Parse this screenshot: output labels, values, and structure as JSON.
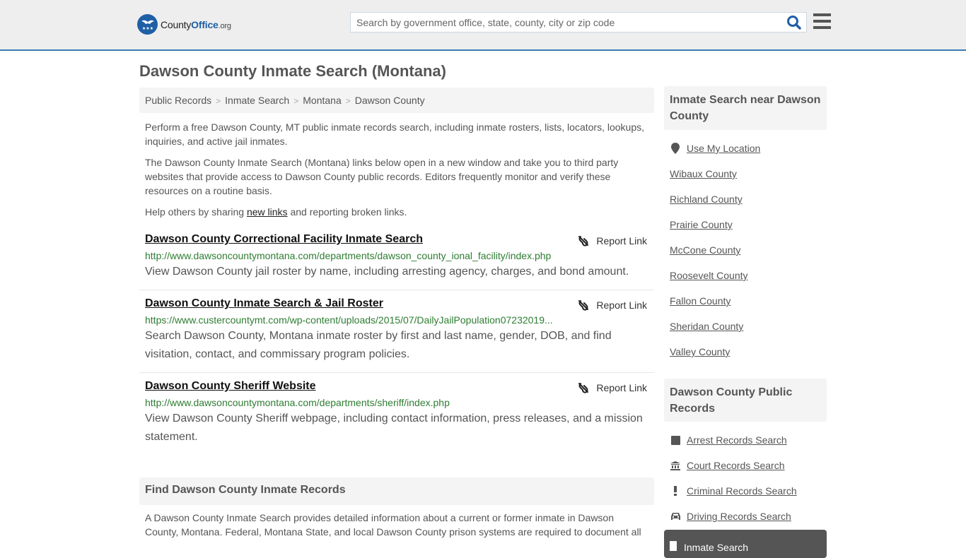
{
  "header": {
    "logo": {
      "name_part1": "County",
      "name_part2": "Office",
      "suffix": ".org"
    },
    "search": {
      "placeholder": "Search by government office, state, county, city or zip code",
      "value": ""
    }
  },
  "page_title": "Dawson County Inmate Search (Montana)",
  "breadcrumb": [
    "Public Records",
    "Inmate Search",
    "Montana",
    "Dawson County"
  ],
  "intro": {
    "p1": "Perform a free Dawson County, MT public inmate records search, including inmate rosters, lists, locators, lookups, inquiries, and active jail inmates.",
    "p2": "The Dawson County Inmate Search (Montana) links below open in a new window and take you to third party websites that provide access to Dawson County public records. Editors frequently monitor and verify these resources on a routine basis.",
    "p3_before": "Help others by sharing ",
    "p3_link": "new links",
    "p3_after": " and reporting broken links."
  },
  "results": [
    {
      "title": "Dawson County Correctional Facility Inmate Search",
      "url": "http://www.dawsoncountymontana.com/departments/dawson_county_ional_facility/index.php",
      "description": "View Dawson County jail roster by name, including arresting agency, charges, and bond amount.",
      "report_label": "Report Link"
    },
    {
      "title": "Dawson County Inmate Search & Jail Roster",
      "url": "https://www.custercountymt.com/wp-content/uploads/2015/07/DailyJailPopulation07232019...",
      "description": "Search Dawson County, Montana inmate roster by first and last name, gender, DOB, and find visitation, contact, and commissary program policies.",
      "report_label": "Report Link"
    },
    {
      "title": "Dawson County Sheriff Website",
      "url": "http://www.dawsoncountymontana.com/departments/sheriff/index.php",
      "description": "View Dawson County Sheriff webpage, including contact information, press releases, and a mission statement.",
      "report_label": "Report Link"
    }
  ],
  "find_section": {
    "heading": "Find Dawson County Inmate Records",
    "text": "A Dawson County Inmate Search provides detailed information about a current or former inmate in Dawson County, Montana. Federal, Montana State, and local Dawson County prison systems are required to document all"
  },
  "sidebar": {
    "nearby": {
      "heading": "Inmate Search near Dawson County",
      "use_location": "Use My Location",
      "counties": [
        "Wibaux County",
        "Richland County",
        "Prairie County",
        "McCone County",
        "Roosevelt County",
        "Fallon County",
        "Sheridan County",
        "Valley County"
      ]
    },
    "public_records": {
      "heading": "Dawson County Public Records",
      "items": [
        {
          "label": "Arrest Records Search",
          "icon": "square-icon"
        },
        {
          "label": "Court Records Search",
          "icon": "courthouse-icon"
        },
        {
          "label": "Criminal Records Search",
          "icon": "exclamation-icon"
        },
        {
          "label": "Driving Records Search",
          "icon": "car-icon"
        },
        {
          "label": "Inmate Search",
          "icon": "door-icon",
          "active": true
        }
      ]
    }
  }
}
